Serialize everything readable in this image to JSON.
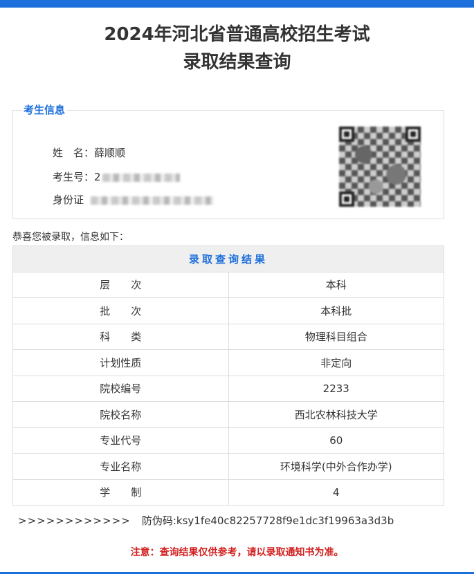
{
  "page": {
    "title_line1": "2024年河北省普通高校招生考试",
    "title_line2": "录取结果查询",
    "accent_color": "#1d6fdc",
    "notice_color": "#d21f1f"
  },
  "candidate": {
    "legend": "考生信息",
    "name_label": "姓　名：",
    "name_value": "薛顺顺",
    "exam_no_label": "考生号：",
    "exam_no_value": "2",
    "id_label": "身份证",
    "qr_icon": "qr-code-icon"
  },
  "congrats_text": "恭喜您被录取，信息如下：",
  "result_table": {
    "header": "录取查询结果",
    "rows": [
      {
        "label": "层　　次",
        "value": "本科"
      },
      {
        "label": "批　　次",
        "value": "本科批"
      },
      {
        "label": "科　　类",
        "value": "物理科目组合"
      },
      {
        "label": "计划性质",
        "value": "非定向"
      },
      {
        "label": "院校编号",
        "value": "2233"
      },
      {
        "label": "院校名称",
        "value": "西北农林科技大学"
      },
      {
        "label": "专业代号",
        "value": "60"
      },
      {
        "label": "专业名称",
        "value": "环境科学(中外合作办学)"
      },
      {
        "label": "学　　制",
        "value": "4"
      }
    ]
  },
  "anti_fake": {
    "arrows": ">>>>>>>>>>>>",
    "label": "防伪码:",
    "code": "ksy1fe40c82257728f9e1dc3f19963a3d3b"
  },
  "notice": "注意：查询结果仅供参考，请以录取通知书为准。"
}
